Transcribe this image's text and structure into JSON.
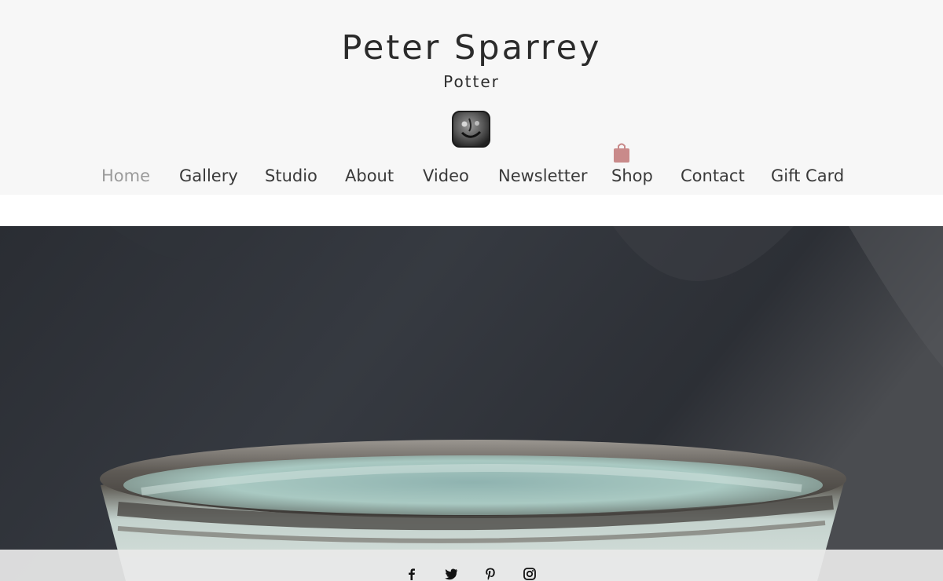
{
  "site": {
    "title": "Peter Sparrey",
    "subtitle": "Potter"
  },
  "nav": {
    "items": [
      {
        "label": "Home",
        "active": true
      },
      {
        "label": "Gallery"
      },
      {
        "label": "Studio"
      },
      {
        "label": "About"
      },
      {
        "label": "Video"
      },
      {
        "label": "Newsletter"
      },
      {
        "label": "Shop"
      },
      {
        "label": "Contact"
      },
      {
        "label": "Gift Card"
      }
    ]
  },
  "colors": {
    "header_bg": "#f7f7f7",
    "nav_active": "#9b9b9b",
    "nav_text": "#3a3a3a",
    "cart_icon": "#c98a8a"
  },
  "icons": {
    "logo": "face-seal-logo",
    "cart": "shopping-bag-icon",
    "social": [
      "facebook-icon",
      "twitter-icon",
      "pinterest-icon",
      "instagram-icon"
    ]
  }
}
